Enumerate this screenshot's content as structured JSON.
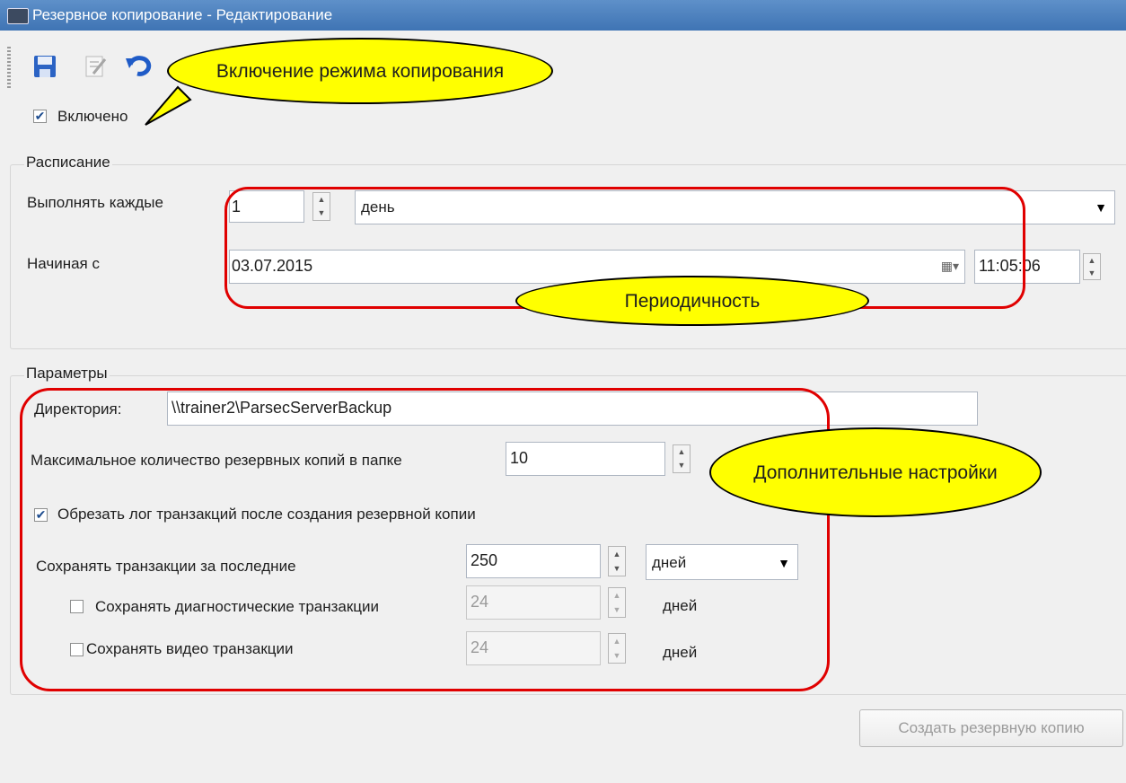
{
  "window": {
    "title": "Резервное копирование - Редактирование"
  },
  "toolbar": {
    "buttons": [
      {
        "name": "save-icon"
      },
      {
        "name": "edit-icon"
      },
      {
        "name": "undo-icon"
      }
    ]
  },
  "enabled": {
    "label": "Включено",
    "checked": true
  },
  "schedule": {
    "legend": "Расписание",
    "every_label": "Выполнять каждые",
    "every_value": "1",
    "unit_value": "день",
    "start_label": "Начиная с",
    "start_date": "03.07.2015",
    "start_time": "11:05:06"
  },
  "params": {
    "legend": "Параметры",
    "dir_label": "Директория:",
    "dir_value": "\\\\trainer2\\ParsecServerBackup",
    "max_label": "Максимальное количество резервных копий в папке",
    "max_value": "10",
    "truncate_label": "Обрезать лог транзакций после создания резервной копии",
    "truncate_checked": true,
    "keep_label": "Сохранять транзакции за последние",
    "keep_value": "250",
    "keep_unit": "дней",
    "diag_label": "Сохранять диагностические транзакции",
    "diag_checked": false,
    "diag_value": "24",
    "diag_unit": "дней",
    "video_label": "Сохранять видео транзакции",
    "video_checked": false,
    "video_value": "24",
    "video_unit": "дней"
  },
  "create_button": "Создать резервную копию",
  "callouts": {
    "mode": "Включение режима копирования",
    "period": "Периодичность",
    "extra": "Дополнительные настройки"
  },
  "colors": {
    "highlight": "#e00000",
    "callout": "#ffff00",
    "titlebar": "#4a7fbf"
  }
}
